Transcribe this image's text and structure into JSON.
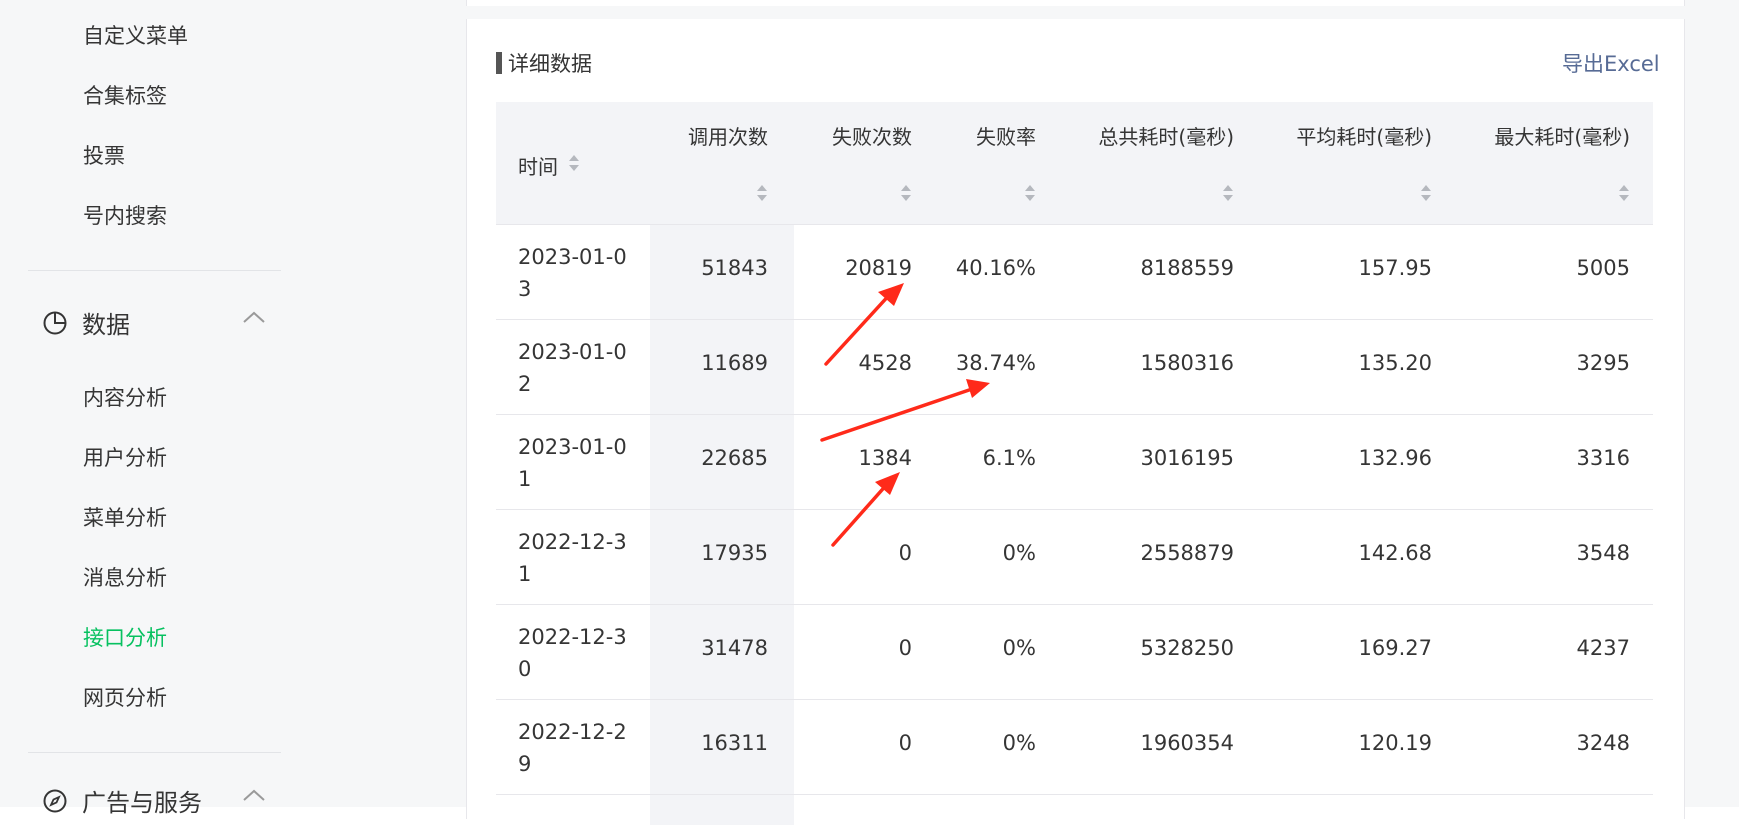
{
  "sidebar": {
    "items_top": [
      "自定义菜单",
      "合集标签",
      "投票",
      "号内搜索"
    ],
    "group_data": {
      "label": "数据",
      "icon": "pie-chart-icon"
    },
    "items_data": [
      "内容分析",
      "用户分析",
      "菜单分析",
      "消息分析",
      "接口分析",
      "网页分析"
    ],
    "active_item": "接口分析",
    "group_ads": {
      "label": "广告与服务",
      "icon": "compass-icon"
    }
  },
  "section": {
    "title": "详细数据",
    "export_label": "导出Excel"
  },
  "table": {
    "headers": [
      "时间",
      "调用次数",
      "失败次数",
      "失败率",
      "总共耗时(毫秒)",
      "平均耗时(毫秒)",
      "最大耗时(毫秒)"
    ],
    "rows": [
      {
        "date": "2023-01-03",
        "calls": "51843",
        "fails": "20819",
        "fail_rate": "40.16%",
        "total_ms": "8188559",
        "avg_ms": "157.95",
        "max_ms": "5005"
      },
      {
        "date": "2023-01-02",
        "calls": "11689",
        "fails": "4528",
        "fail_rate": "38.74%",
        "total_ms": "1580316",
        "avg_ms": "135.20",
        "max_ms": "3295"
      },
      {
        "date": "2023-01-01",
        "calls": "22685",
        "fails": "1384",
        "fail_rate": "6.1%",
        "total_ms": "3016195",
        "avg_ms": "132.96",
        "max_ms": "3316"
      },
      {
        "date": "2022-12-31",
        "calls": "17935",
        "fails": "0",
        "fail_rate": "0%",
        "total_ms": "2558879",
        "avg_ms": "142.68",
        "max_ms": "3548"
      },
      {
        "date": "2022-12-30",
        "calls": "31478",
        "fails": "0",
        "fail_rate": "0%",
        "total_ms": "5328250",
        "avg_ms": "169.27",
        "max_ms": "4237"
      },
      {
        "date": "2022-12-29",
        "calls": "16311",
        "fails": "0",
        "fail_rate": "0%",
        "total_ms": "1960354",
        "avg_ms": "120.19",
        "max_ms": "3248"
      }
    ]
  },
  "colors": {
    "accent_green": "#07c160",
    "link_blue": "#576b95",
    "annotation_red": "#ff2a1a"
  }
}
